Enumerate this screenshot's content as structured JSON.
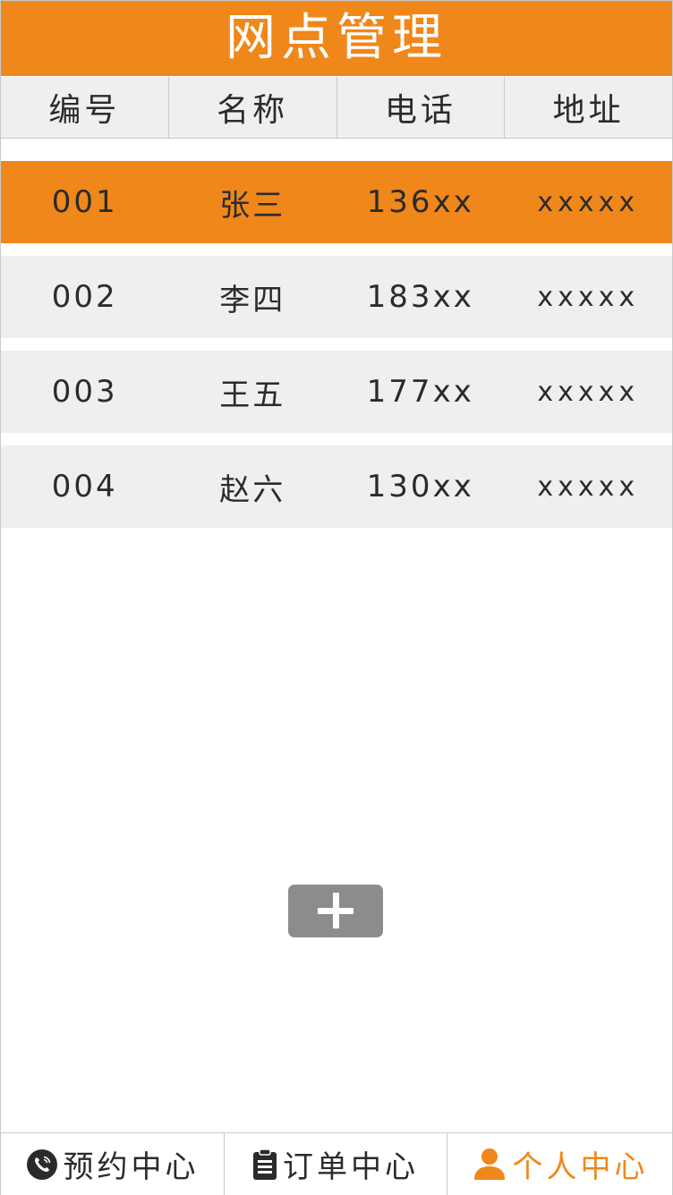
{
  "header": {
    "title": "网点管理"
  },
  "table": {
    "columns": [
      "编号",
      "名称",
      "电话",
      "地址"
    ],
    "rows": [
      {
        "id": "001",
        "name": "张三",
        "phone": "136xx",
        "address": "xxxxx",
        "selected": true
      },
      {
        "id": "002",
        "name": "李四",
        "phone": "183xx",
        "address": "xxxxx",
        "selected": false
      },
      {
        "id": "003",
        "name": "王五",
        "phone": "177xx",
        "address": "xxxxx",
        "selected": false
      },
      {
        "id": "004",
        "name": "赵六",
        "phone": "130xx",
        "address": "xxxxx",
        "selected": false
      }
    ]
  },
  "add_button": {
    "icon": "plus-icon"
  },
  "nav": {
    "items": [
      {
        "label": "预约中心",
        "icon": "phone-icon",
        "active": false
      },
      {
        "label": "订单中心",
        "icon": "clipboard-icon",
        "active": false
      },
      {
        "label": "个人中心",
        "icon": "user-icon",
        "active": true
      }
    ]
  },
  "colors": {
    "accent": "#f0871a",
    "row_bg": "#efefef",
    "button_bg": "#8c8c8c",
    "text": "#2b2b2b"
  }
}
